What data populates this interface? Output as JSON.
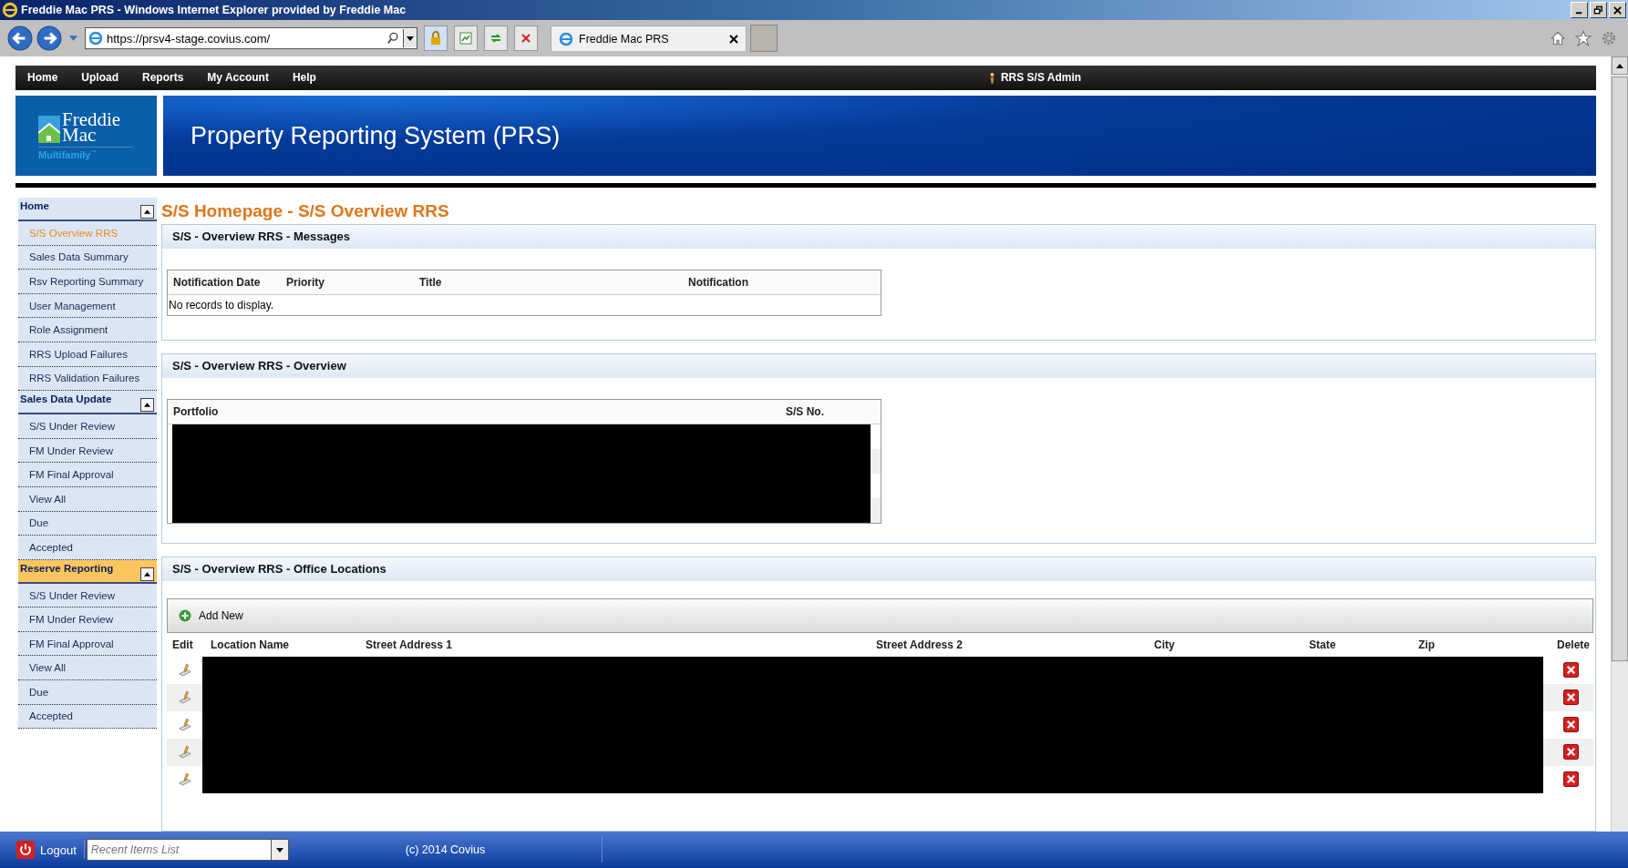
{
  "window": {
    "title": "Freddie Mac PRS - Windows Internet Explorer provided by Freddie Mac"
  },
  "browser": {
    "address": "https://prsv4-stage.covius.com/",
    "tabs": [
      {
        "label": "Freddie Mac PRS",
        "selected": true
      }
    ]
  },
  "top_nav": {
    "items": [
      "Home",
      "Upload",
      "Reports",
      "My Account",
      "Help"
    ],
    "user": "RRS S/S Admin"
  },
  "header": {
    "logo_line1": "Freddie",
    "logo_line2": "Mac",
    "logo_sub": "Multifamily",
    "logo_tm": "™",
    "title": "Property Reporting System (PRS)"
  },
  "sidebar": {
    "sections": [
      {
        "title": "Home",
        "selected": false,
        "items": [
          {
            "label": "S/S Overview RRS",
            "selected": true
          },
          {
            "label": "Sales Data Summary",
            "selected": false
          },
          {
            "label": "Rsv Reporting Summary",
            "selected": false
          },
          {
            "label": "User Management",
            "selected": false
          },
          {
            "label": "Role Assignment",
            "selected": false
          },
          {
            "label": "RRS Upload Failures",
            "selected": false
          },
          {
            "label": "RRS Validation Failures",
            "selected": false
          }
        ]
      },
      {
        "title": "Sales Data Update",
        "selected": false,
        "items": [
          {
            "label": "S/S Under Review",
            "selected": false
          },
          {
            "label": "FM Under Review",
            "selected": false
          },
          {
            "label": "FM Final Approval",
            "selected": false
          },
          {
            "label": "View All",
            "selected": false
          },
          {
            "label": "Due",
            "selected": false
          },
          {
            "label": "Accepted",
            "selected": false
          }
        ]
      },
      {
        "title": "Reserve Reporting",
        "selected": true,
        "items": [
          {
            "label": "S/S Under Review",
            "selected": false
          },
          {
            "label": "FM Under Review",
            "selected": false
          },
          {
            "label": "FM Final Approval",
            "selected": false
          },
          {
            "label": "View All",
            "selected": false
          },
          {
            "label": "Due",
            "selected": false
          },
          {
            "label": "Accepted",
            "selected": false
          }
        ]
      }
    ]
  },
  "page_title": "S/S Homepage - S/S Overview RRS",
  "messages": {
    "title": "S/S - Overview RRS - Messages",
    "columns": [
      "Notification Date",
      "Priority",
      "Title",
      "Notification"
    ],
    "empty_text": "No records to display."
  },
  "overview": {
    "title": "S/S - Overview RRS - Overview",
    "columns": [
      "Portfolio",
      "S/S No."
    ]
  },
  "offices": {
    "title": "S/S - Overview RRS - Office Locations",
    "add_label": "Add New",
    "columns": [
      "Edit",
      "Location Name",
      "Street Address 1",
      "Street Address 2",
      "City",
      "State",
      "Zip",
      "Delete"
    ],
    "rows": [
      {
        "kind": "redacted"
      },
      {
        "kind": "redacted"
      },
      {
        "kind": "redacted"
      },
      {
        "kind": "redacted"
      },
      {
        "kind": "redacted"
      }
    ]
  },
  "footer": {
    "logout": "Logout",
    "recent_placeholder": "Recent Items List",
    "copyright": "(c) 2014 Covius"
  }
}
